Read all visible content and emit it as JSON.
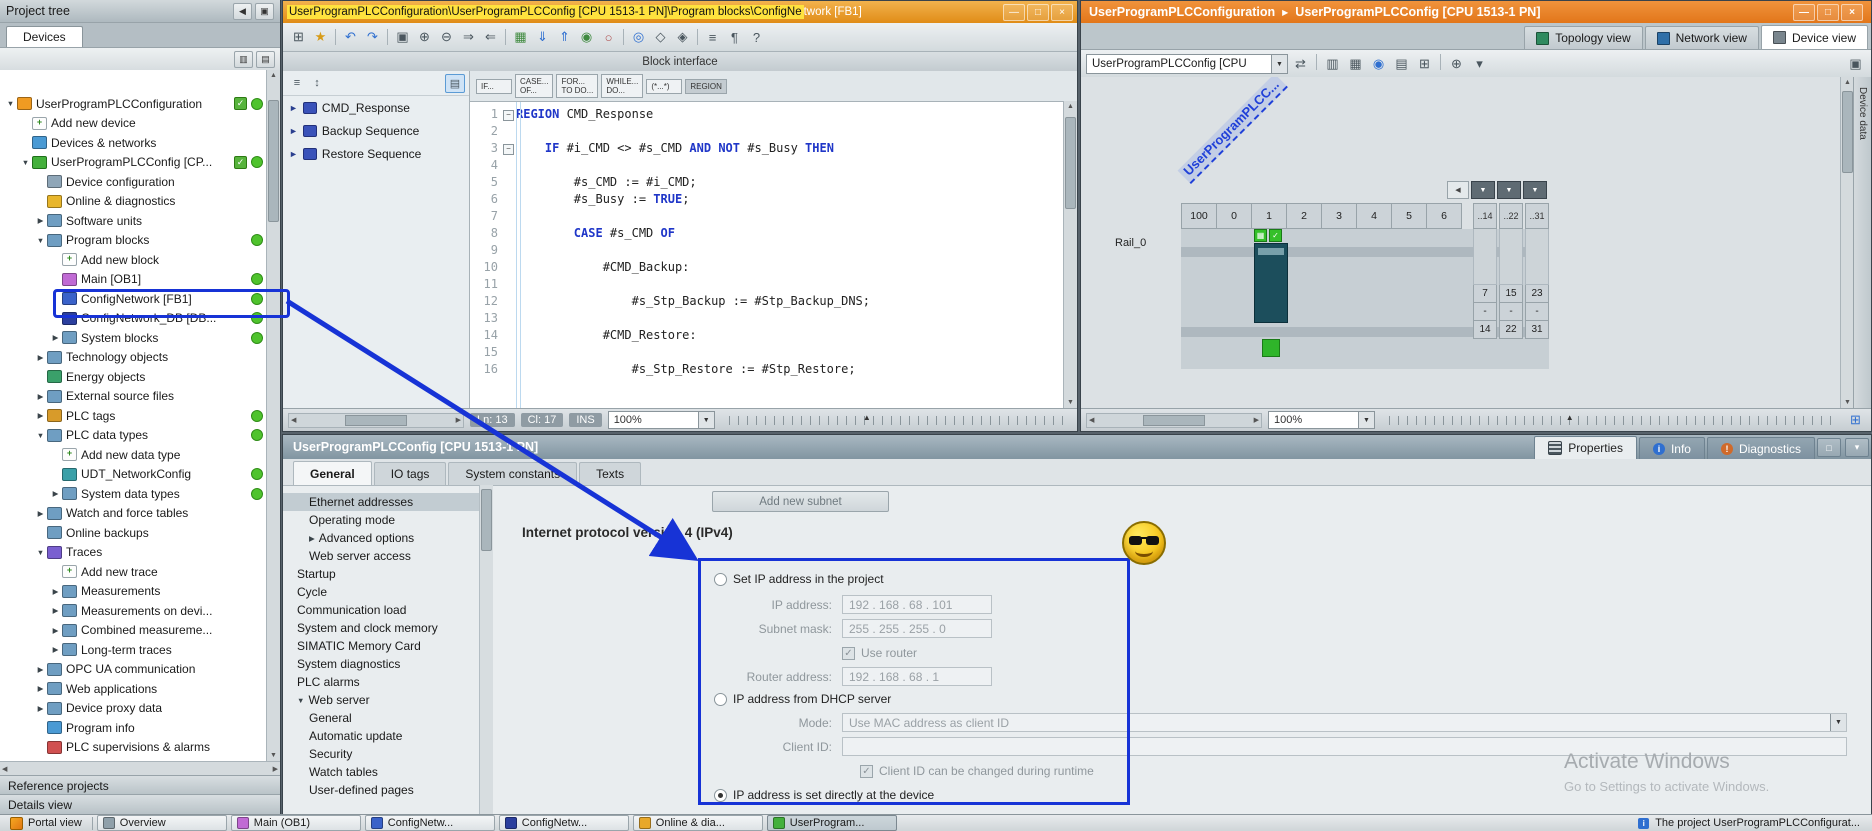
{
  "window": {
    "buttons": [
      "minimize",
      "maximize",
      "close"
    ]
  },
  "project_tree": {
    "header": "Project tree",
    "tab": "Devices",
    "items": [
      {
        "label": "UserProgramPLCConfiguration",
        "level": 0,
        "expander": "down",
        "icon": "project-icon",
        "status": "check-dot"
      },
      {
        "label": "Add new device",
        "level": 1,
        "icon": "add-icon"
      },
      {
        "label": "Devices & networks",
        "level": 1,
        "icon": "network-icon"
      },
      {
        "label": "UserProgramPLCConfig [CP...",
        "level": 1,
        "expander": "down",
        "icon": "plc-icon",
        "status": "check-dot"
      },
      {
        "label": "Device configuration",
        "level": 2,
        "icon": "device-config-icon"
      },
      {
        "label": "Online & diagnostics",
        "level": 2,
        "icon": "online-diag-icon"
      },
      {
        "label": "Software units",
        "level": 2,
        "expander": "right",
        "icon": "folder-icon"
      },
      {
        "label": "Program blocks",
        "level": 2,
        "expander": "down",
        "icon": "folder-icon",
        "status": "dot"
      },
      {
        "label": "Add new block",
        "level": 3,
        "icon": "add-icon"
      },
      {
        "label": "Main [OB1]",
        "level": 3,
        "icon": "ob-block-icon",
        "status": "dot"
      },
      {
        "label": "ConfigNetwork [FB1]",
        "level": 3,
        "icon": "fb-block-icon",
        "status": "dot",
        "highlight": true
      },
      {
        "label": "ConfigNetwork_DB [DB...",
        "level": 3,
        "icon": "db-block-icon",
        "status": "dot"
      },
      {
        "label": "System blocks",
        "level": 3,
        "expander": "right",
        "icon": "folder-icon",
        "status": "dot"
      },
      {
        "label": "Technology objects",
        "level": 2,
        "expander": "right",
        "icon": "folder-icon"
      },
      {
        "label": "Energy objects",
        "level": 2,
        "icon": "energy-icon"
      },
      {
        "label": "External source files",
        "level": 2,
        "expander": "right",
        "icon": "folder-icon"
      },
      {
        "label": "PLC tags",
        "level": 2,
        "expander": "right",
        "icon": "tags-icon",
        "status": "dot"
      },
      {
        "label": "PLC data types",
        "level": 2,
        "expander": "down",
        "icon": "folder-icon",
        "status": "dot"
      },
      {
        "label": "Add new data type",
        "level": 3,
        "icon": "add-icon"
      },
      {
        "label": "UDT_NetworkConfig",
        "level": 3,
        "icon": "udt-icon",
        "status": "dot"
      },
      {
        "label": "System data types",
        "level": 3,
        "expander": "right",
        "icon": "folder-icon",
        "status": "dot"
      },
      {
        "label": "Watch and force tables",
        "level": 2,
        "expander": "right",
        "icon": "folder-icon"
      },
      {
        "label": "Online backups",
        "level": 2,
        "icon": "folder-icon"
      },
      {
        "label": "Traces",
        "level": 2,
        "expander": "down",
        "icon": "traces-icon"
      },
      {
        "label": "Add new trace",
        "level": 3,
        "icon": "add-icon"
      },
      {
        "label": "Measurements",
        "level": 3,
        "expander": "right",
        "icon": "folder-icon"
      },
      {
        "label": "Measurements on devi...",
        "level": 3,
        "expander": "right",
        "icon": "folder-icon"
      },
      {
        "label": "Combined measureme...",
        "level": 3,
        "expander": "right",
        "icon": "folder-icon"
      },
      {
        "label": "Long-term traces",
        "level": 3,
        "expander": "right",
        "icon": "folder-icon"
      },
      {
        "label": "OPC UA communication",
        "level": 2,
        "expander": "right",
        "icon": "folder-icon"
      },
      {
        "label": "Web applications",
        "level": 2,
        "expander": "right",
        "icon": "folder-icon"
      },
      {
        "label": "Device proxy data",
        "level": 2,
        "expander": "right",
        "icon": "folder-icon"
      },
      {
        "label": "Program info",
        "level": 2,
        "icon": "info-icon"
      },
      {
        "label": "PLC supervisions & alarms",
        "level": 2,
        "icon": "alarm-icon"
      }
    ],
    "header_icons": [
      {
        "name": "collapse-panel-left-icon",
        "glyph": "◀"
      },
      {
        "name": "pin-panel-icon",
        "glyph": "▣"
      }
    ],
    "toolbar_icons": [
      {
        "name": "filter-columns-icon",
        "glyph": "▥"
      },
      {
        "name": "details-columns-icon",
        "glyph": "▤"
      }
    ],
    "footer_sections": [
      "Reference projects",
      "Details view"
    ]
  },
  "editor": {
    "title_highlighted": "UserProgramPLCConfiguration\\UserProgramPLCConfig [CPU 1513-1 PN]\\Program blocks\\ConfigNe",
    "title_rest": "twork [FB1]",
    "toolbar": [
      {
        "n": "insert-row-icon",
        "g": "⊞"
      },
      {
        "n": "favorites-icon",
        "g": "★",
        "c": "#d79b18"
      },
      {
        "sep": true
      },
      {
        "n": "undo-icon",
        "g": "↶",
        "c": "#2f6fd0"
      },
      {
        "n": "redo-icon",
        "g": "↷",
        "c": "#2f6fd0"
      },
      {
        "sep": true
      },
      {
        "n": "absolute-operands-icon",
        "g": "▣"
      },
      {
        "n": "expand-all-icon",
        "g": "⊕"
      },
      {
        "n": "collapse-all-icon",
        "g": "⊖"
      },
      {
        "n": "indent-icon",
        "g": "⇒"
      },
      {
        "n": "outdent-icon",
        "g": "⇐"
      },
      {
        "sep": true
      },
      {
        "n": "compile-icon",
        "g": "▦",
        "c": "#3f8a3f"
      },
      {
        "n": "download-icon",
        "g": "⇓",
        "c": "#2f6fd0"
      },
      {
        "n": "upload-icon",
        "g": "⇑",
        "c": "#2f6fd0"
      },
      {
        "n": "go-online-icon",
        "g": "◉",
        "c": "#3f8a3f"
      },
      {
        "n": "go-offline-icon",
        "g": "○",
        "c": "#b05050"
      },
      {
        "sep": true
      },
      {
        "n": "monitor-icon",
        "g": "◎",
        "c": "#2f6fd0"
      },
      {
        "n": "snapshot-icon",
        "g": "◇"
      },
      {
        "n": "keep-values-icon",
        "g": "◈"
      },
      {
        "sep": true
      },
      {
        "n": "structure-icon",
        "g": "≡"
      },
      {
        "n": "comment-icon",
        "g": "¶"
      },
      {
        "n": "help-icon",
        "g": "?"
      }
    ],
    "block_interface_label": "Block interface",
    "regions_header_icons": [
      {
        "name": "expand-regions-icon",
        "glyph": "≡"
      },
      {
        "name": "navigate-regions-icon",
        "glyph": "↕"
      }
    ],
    "regions": [
      "CMD_Response",
      "Backup Sequence",
      "Restore Sequence"
    ],
    "snippets": [
      "IF...",
      "CASE...\nOF...",
      "FOR...\nTO DO...",
      "WHILE...\nDO...",
      "(*...*)",
      "REGION"
    ],
    "code": [
      {
        "n": 1,
        "t": "REGION CMD_Response",
        "fold": true
      },
      {
        "n": 2,
        "t": ""
      },
      {
        "n": 3,
        "t": "    IF #i_CMD <> #s_CMD AND NOT #s_Busy THEN",
        "fold": true
      },
      {
        "n": 4,
        "t": ""
      },
      {
        "n": 5,
        "t": "        #s_CMD := #i_CMD;"
      },
      {
        "n": 6,
        "t": "        #s_Busy := TRUE;"
      },
      {
        "n": 7,
        "t": ""
      },
      {
        "n": 8,
        "t": "        CASE #s_CMD OF"
      },
      {
        "n": 9,
        "t": ""
      },
      {
        "n": 10,
        "t": "            #CMD_Backup:"
      },
      {
        "n": 11,
        "t": ""
      },
      {
        "n": 12,
        "t": "                #s_Stp_Backup := #Stp_Backup_DNS;"
      },
      {
        "n": 13,
        "t": ""
      },
      {
        "n": 14,
        "t": "            #CMD_Restore:"
      },
      {
        "n": 15,
        "t": ""
      },
      {
        "n": 16,
        "t": "                #s_Stp_Restore := #Stp_Restore;"
      }
    ],
    "status": {
      "ln": "Ln: 13",
      "cl": "Cl: 17",
      "mode": "INS",
      "zoom": "100%"
    }
  },
  "device_view": {
    "breadcrumb": [
      "UserProgramPLCConfiguration",
      "UserProgramPLCConfig [CPU 1513-1 PN]"
    ],
    "view_tabs": [
      {
        "label": "Topology view",
        "icon": "topology-view-icon"
      },
      {
        "label": "Network view",
        "icon": "network-view-icon"
      },
      {
        "label": "Device view",
        "icon": "device-view-icon",
        "active": true
      }
    ],
    "device_select": "UserProgramPLCConfig [CPU",
    "toolbar": [
      {
        "n": "detect-device-icon",
        "g": "⇄"
      },
      {
        "sep": true
      },
      {
        "n": "labels-icon",
        "g": "▥"
      },
      {
        "n": "rack-view-icon",
        "g": "▦"
      },
      {
        "n": "monitor-icon",
        "g": "◉",
        "c": "#2f6fd0"
      },
      {
        "n": "table-view-icon",
        "g": "▤"
      },
      {
        "n": "grid-icon",
        "g": "⊞"
      },
      {
        "sep": true
      },
      {
        "n": "zoom-in-icon",
        "g": "⊕"
      },
      {
        "n": "zoom-select-icon",
        "g": "▾"
      }
    ],
    "rotated_label": "UserProgramPLCC...",
    "rail_label": "Rail_0",
    "slot_headers": [
      "100",
      "0",
      "1",
      "2",
      "3",
      "4",
      "5",
      "6"
    ],
    "slot_groups": [
      {
        "header": "..14",
        "top": "7",
        "mid": "-",
        "bottom": "14"
      },
      {
        "header": "..22",
        "top": "15",
        "mid": "-",
        "bottom": "22"
      },
      {
        "header": "..31",
        "top": "23",
        "mid": "-",
        "bottom": "31"
      }
    ],
    "zoom": "100%",
    "side_tab": "Device data"
  },
  "properties": {
    "title": "UserProgramPLCConfig [CPU 1513-1 PN]",
    "right_tabs": [
      {
        "label": "Properties",
        "icon": "properties-icon",
        "active": true
      },
      {
        "label": "Info",
        "icon": "info-tab-icon"
      },
      {
        "label": "Diagnostics",
        "icon": "diagnostics-icon"
      }
    ],
    "panel_buttons": [
      "maximize",
      "collapse"
    ],
    "tabs": [
      {
        "label": "General",
        "active": true
      },
      {
        "label": "IO tags"
      },
      {
        "label": "System constants"
      },
      {
        "label": "Texts"
      }
    ],
    "nav": [
      {
        "label": "Ethernet addresses",
        "level": 1,
        "selected": true
      },
      {
        "label": "Operating mode",
        "level": 1
      },
      {
        "label": "Advanced options",
        "level": 1,
        "expander": "right"
      },
      {
        "label": "Web server access",
        "level": 1
      },
      {
        "label": "Startup",
        "level": 0
      },
      {
        "label": "Cycle",
        "level": 0
      },
      {
        "label": "Communication load",
        "level": 0
      },
      {
        "label": "System and clock memory",
        "level": 0
      },
      {
        "label": "SIMATIC Memory Card",
        "level": 0
      },
      {
        "label": "System diagnostics",
        "level": 0
      },
      {
        "label": "PLC alarms",
        "level": 0
      },
      {
        "label": "Web server",
        "level": 0,
        "expander": "down"
      },
      {
        "label": "General",
        "level": 1
      },
      {
        "label": "Automatic update",
        "level": 1
      },
      {
        "label": "Security",
        "level": 1
      },
      {
        "label": "Watch tables",
        "level": 1
      },
      {
        "label": "User-defined pages",
        "level": 1
      }
    ],
    "content": {
      "add_new_subnet": "Add new subnet",
      "section_title": "Internet protocol version 4 (IPv4)",
      "radio_project": "Set IP address in the project",
      "ip_label": "IP address:",
      "ip_value": "192 . 168 . 68   . 101",
      "mask_label": "Subnet mask:",
      "mask_value": "255 . 255 . 255 . 0",
      "use_router_label": "Use router",
      "router_label": "Router address:",
      "router_value": "192 . 168 . 68   . 1",
      "radio_dhcp": "IP address from DHCP server",
      "mode_label": "Mode:",
      "mode_value": "Use MAC address as client ID",
      "client_id_label": "Client ID:",
      "client_id_value": "",
      "client_runtime_label": "Client ID can be changed during runtime",
      "radio_device": "IP address is set directly at the device"
    }
  },
  "watermark": {
    "line1": "Activate Windows",
    "line2": "Go to Settings to activate Windows."
  },
  "taskbar": {
    "portal_label": "Portal view",
    "buttons": [
      {
        "label": "Overview",
        "icon": "overview-icon"
      },
      {
        "label": "Main (OB1)",
        "icon": "ob-block-icon"
      },
      {
        "label": "ConfigNetw...",
        "icon": "fb-block-icon"
      },
      {
        "label": "ConfigNetw...",
        "icon": "db-block-icon"
      },
      {
        "label": "Online & dia...",
        "icon": "online-icon"
      },
      {
        "label": "UserProgram...",
        "icon": "device-icon",
        "active": true
      }
    ],
    "status_text": "The project UserProgramPLCConfigurat..."
  }
}
